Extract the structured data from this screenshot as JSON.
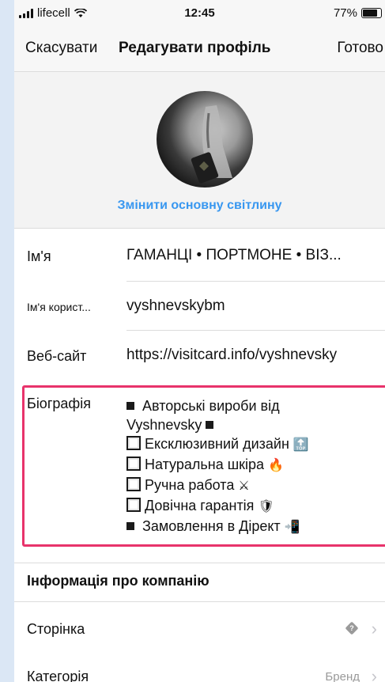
{
  "status_bar": {
    "carrier": "lifecell",
    "time": "12:45",
    "battery": "77%"
  },
  "nav": {
    "cancel": "Скасувати",
    "title": "Редагувати профіль",
    "done": "Готово"
  },
  "profile": {
    "change_photo": "Змінити основну світлину"
  },
  "fields": {
    "name_label": "Ім'я",
    "name_value": "ГАМАНЦІ • ПОРТМОНЕ • ВІЗ...",
    "username_label": "Ім'я корист...",
    "username_value": "vyshnevskybm",
    "website_label": "Веб-сайт",
    "website_value": "https://visitcard.info/vyshnevsky",
    "bio_label": "Біографія",
    "bio_lines": [
      "Авторські вироби від",
      "Vyshnevsky",
      "Ексклюзивний дизайн",
      "Натуральна шкіра",
      "Ручна работа",
      "Довічна гарантія",
      "Замовлення в Дірект"
    ]
  },
  "company": {
    "section_title": "Інформація про компанію",
    "page_label": "Сторінка",
    "category_label": "Категорія",
    "category_value": "Бренд"
  },
  "colors": {
    "accent_blue": "#3897f0",
    "highlight_pink": "#e8336b"
  }
}
